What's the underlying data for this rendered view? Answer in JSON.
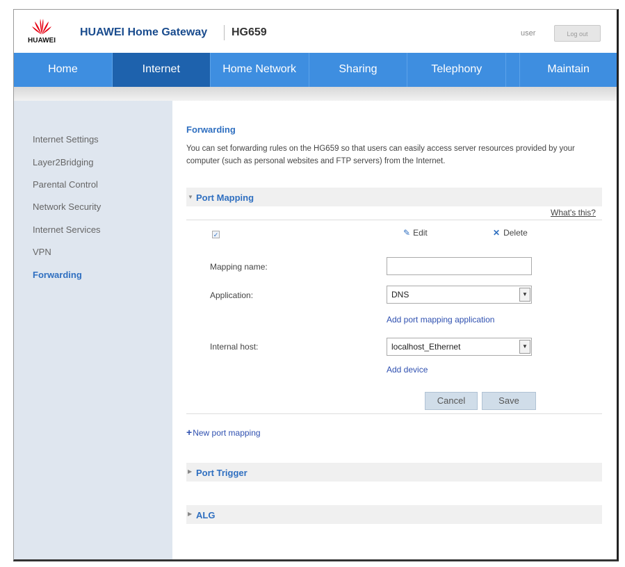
{
  "header": {
    "logo_text": "HUAWEI",
    "app_title": "HUAWEI Home Gateway",
    "model": "HG659",
    "user": "user",
    "logout_label": "Log out",
    "brand_color": "#e60012"
  },
  "nav": {
    "items": [
      {
        "label": "Home"
      },
      {
        "label": "Internet"
      },
      {
        "label": "Home Network"
      },
      {
        "label": "Sharing"
      },
      {
        "label": "Telephony"
      },
      {
        "label": ""
      },
      {
        "label": "Maintain"
      }
    ],
    "active": "Internet",
    "color": "#3e8ee0",
    "active_color": "#1e62ad"
  },
  "sidebar": {
    "items": [
      {
        "label": "Internet Settings"
      },
      {
        "label": "Layer2Bridging"
      },
      {
        "label": "Parental Control"
      },
      {
        "label": "Network Security"
      },
      {
        "label": "Internet Services"
      },
      {
        "label": "VPN"
      },
      {
        "label": "Forwarding"
      }
    ],
    "active": "Forwarding"
  },
  "main": {
    "title": "Forwarding",
    "description": "You can set forwarding rules on the HG659 so that users can easily access server resources provided by your computer (such as personal websites and FTP servers) from the Internet.",
    "port_mapping": {
      "label": "Port Mapping",
      "whats_this": "What's this?",
      "checkbox_mark": "✓",
      "edit_label": "Edit",
      "delete_label": "Delete",
      "form": {
        "mapping_name_label": "Mapping name:",
        "mapping_name_value": "",
        "application_label": "Application:",
        "application_value": "DNS",
        "add_app_link": "Add port mapping application",
        "internal_host_label": "Internal host:",
        "internal_host_value": "localhost_Ethernet",
        "add_device_link": "Add device",
        "cancel_label": "Cancel",
        "save_label": "Save"
      },
      "new_mapping_label": "New port mapping"
    },
    "port_trigger": {
      "label": "Port Trigger"
    },
    "alg": {
      "label": "ALG"
    }
  }
}
